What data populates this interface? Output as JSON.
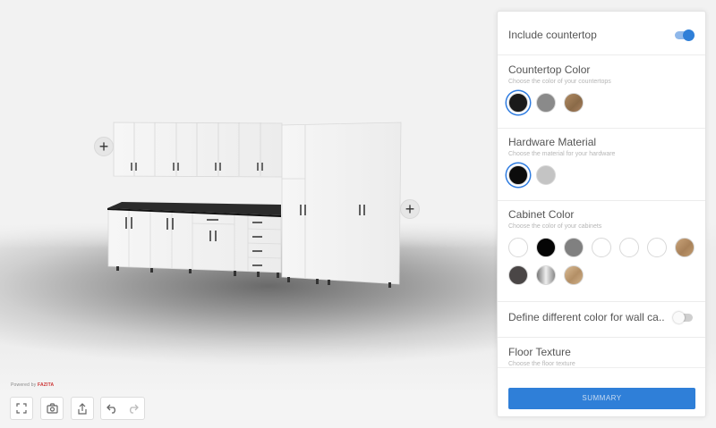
{
  "viewport": {
    "powered_label": "Powered by",
    "powered_brand": "FAZITA"
  },
  "panel": {
    "include_countertop": {
      "label": "Include countertop",
      "on": true
    },
    "countertop_color": {
      "title": "Countertop Color",
      "subtitle": "Choose the color of your countertops",
      "swatches": [
        "black",
        "gray",
        "wood"
      ],
      "selected": 0
    },
    "hardware_material": {
      "title": "Hardware Material",
      "subtitle": "Choose the material for your hardware",
      "swatches": [
        "black",
        "silver"
      ],
      "selected": 0
    },
    "cabinet_color": {
      "title": "Cabinet Color",
      "subtitle": "Choose the color of your cabinets",
      "swatches": [
        "white",
        "black",
        "gray",
        "white",
        "white",
        "white",
        "wood",
        "charcoal",
        "metallic",
        "wood-light"
      ]
    },
    "wall_color_toggle": {
      "label": "Define different color for wall ca...",
      "on": false
    },
    "floor_texture": {
      "title": "Floor Texture",
      "subtitle": "Choose the floor texture"
    },
    "summary_label": "SUMMARY"
  },
  "colors": {
    "accent": "#2f7fd8",
    "cabinet": "#f4f4f4",
    "countertop": "#2b2b2b"
  }
}
